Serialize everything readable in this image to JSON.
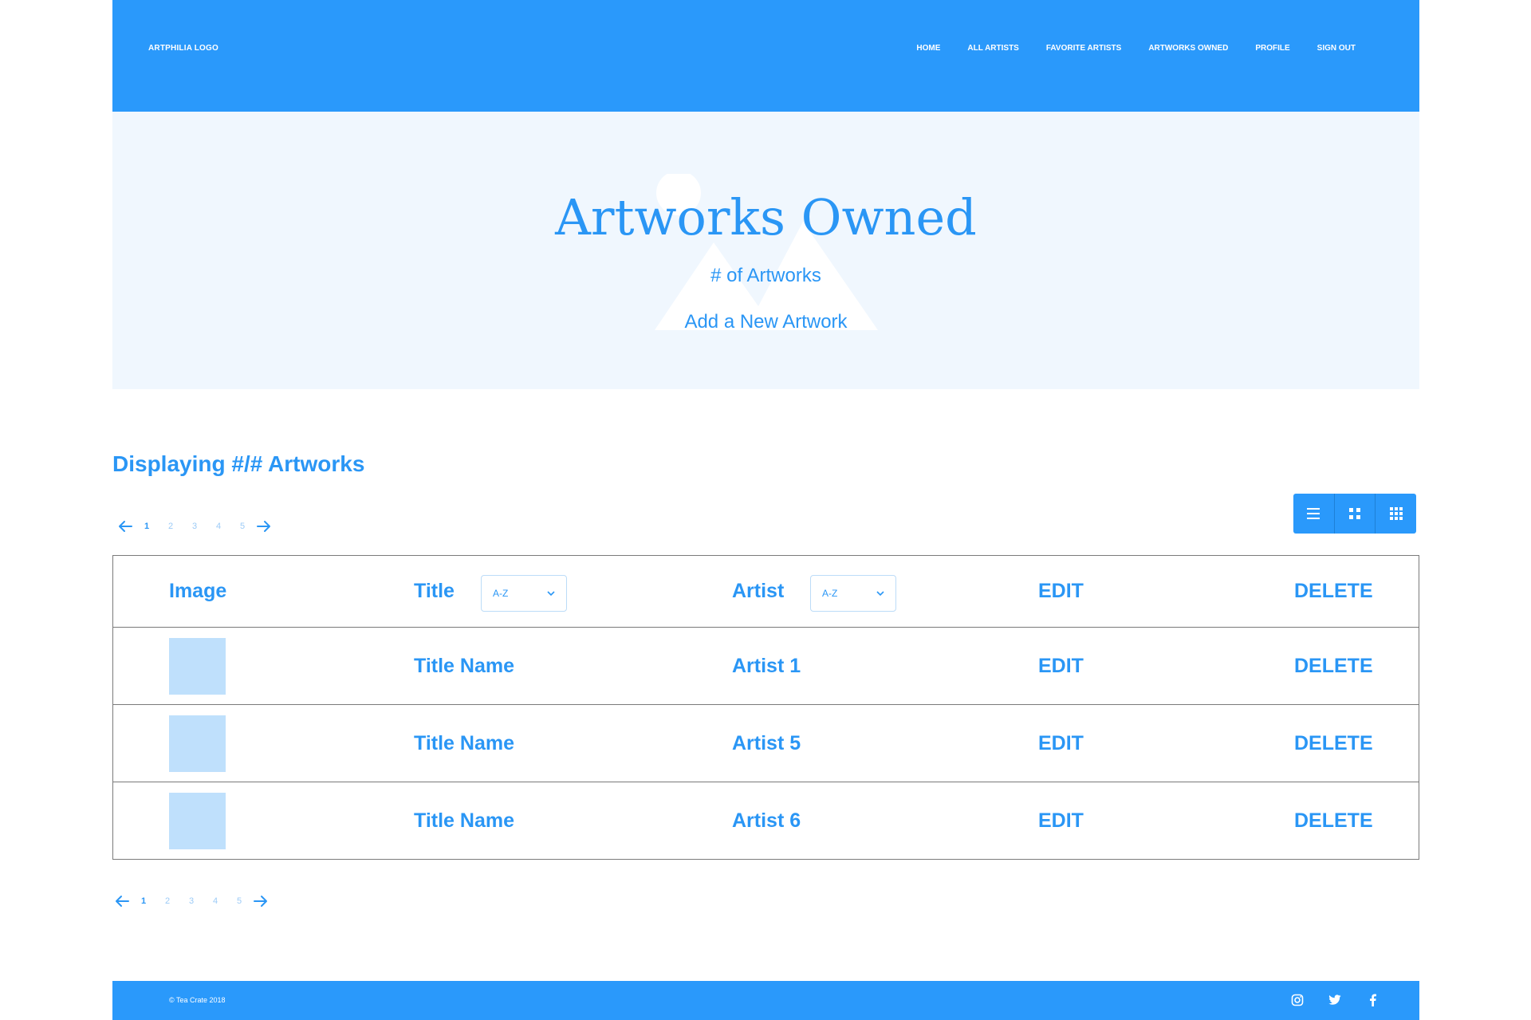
{
  "header": {
    "logo": "ARTPHILIA LOGO",
    "nav": [
      "HOME",
      "ALL ARTISTS",
      "FAVORITE ARTISTS",
      "ARTWORKS OWNED",
      "PROFILE",
      "SIGN OUT"
    ]
  },
  "hero": {
    "title": "Artworks Owned",
    "subtitle": "# of Artworks",
    "add_link": "Add a New Artwork"
  },
  "listing": {
    "heading": "Displaying #/# Artworks",
    "pages": [
      "1",
      "2",
      "3",
      "4",
      "5"
    ],
    "current_page": "1"
  },
  "table": {
    "headers": {
      "image": "Image",
      "title": "Title",
      "title_sort": "A-Z",
      "artist": "Artist",
      "artist_sort": "A-Z",
      "edit": "EDIT",
      "delete": "DELETE"
    },
    "rows": [
      {
        "title": "Title Name",
        "artist": "Artist 1",
        "edit": "EDIT",
        "delete": "DELETE"
      },
      {
        "title": "Title Name",
        "artist": "Artist 5",
        "edit": "EDIT",
        "delete": "DELETE"
      },
      {
        "title": "Title Name",
        "artist": "Artist 6",
        "edit": "EDIT",
        "delete": "DELETE"
      }
    ]
  },
  "footer": {
    "copyright": "© Tea Crate 2018",
    "social_icons": [
      "instagram-icon",
      "twitter-icon",
      "facebook-icon"
    ]
  },
  "colors": {
    "brand": "#2a99fb",
    "text": "#2a96f5",
    "hero_bg": "#f0f7fe",
    "thumb": "#bfe0fc"
  }
}
